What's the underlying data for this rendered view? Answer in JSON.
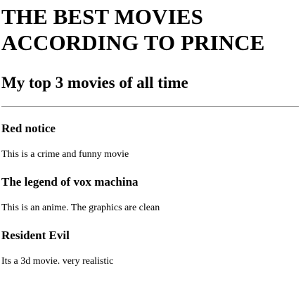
{
  "page": {
    "title": "THE BEST MOVIES ACCORDING TO PRINCE",
    "subtitle": "My top 3 movies of all time"
  },
  "movies": [
    {
      "name": "Red notice",
      "description": "This is a crime and funny movie"
    },
    {
      "name": "The legend of vox machina",
      "description": "This is an anime. The graphics are clean"
    },
    {
      "name": "Resident Evil",
      "description": "Its a 3d movie. very realistic"
    }
  ]
}
